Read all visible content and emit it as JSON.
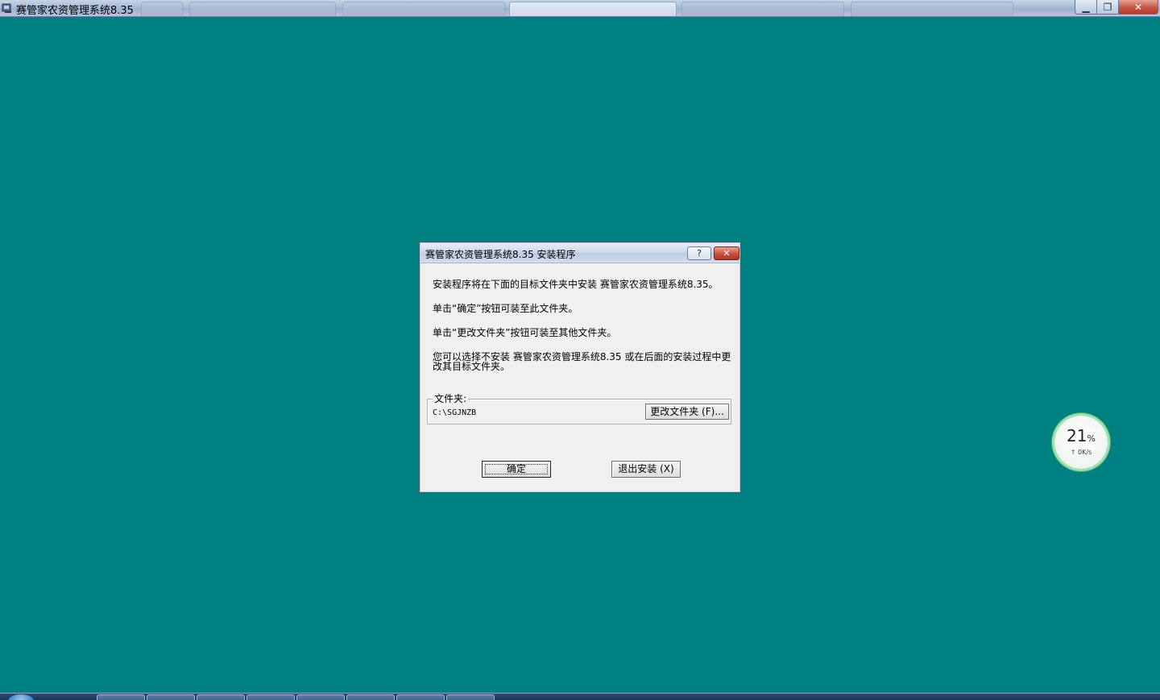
{
  "window": {
    "title": "赛管家农资管理系统8.35",
    "icon": "installer-app-icon",
    "controls": {
      "minimize": "▁",
      "restore": "❐",
      "close": "✕"
    }
  },
  "dialog": {
    "title": "赛管家农资管理系统8.35 安装程序",
    "help_label": "?",
    "close_label": "✕",
    "line1": "安装程序将在下面的目标文件夹中安装 赛管家农资管理系统8.35。",
    "line2": "单击“确定”按钮可装至此文件夹。",
    "line3": "单击“更改文件夹”按钮可装至其他文件夹。",
    "line4": "您可以选择不安装 赛管家农资管理系统8.35 或在后面的安装过程中更改其目标文件夹。",
    "folder_label": "文件夹:",
    "folder_path": "C:\\SGJNZB",
    "change_folder_button": "更改文件夹 (F)...",
    "ok_button": "确定",
    "exit_button": "退出安装 (X)"
  },
  "net_widget": {
    "percent": "21",
    "percent_unit": "%",
    "speed": "0K/s",
    "arrow": "↑"
  },
  "colors": {
    "desktop": "#008080",
    "dialog_bg": "#f0f0f0",
    "close_red": "#c8503f"
  }
}
